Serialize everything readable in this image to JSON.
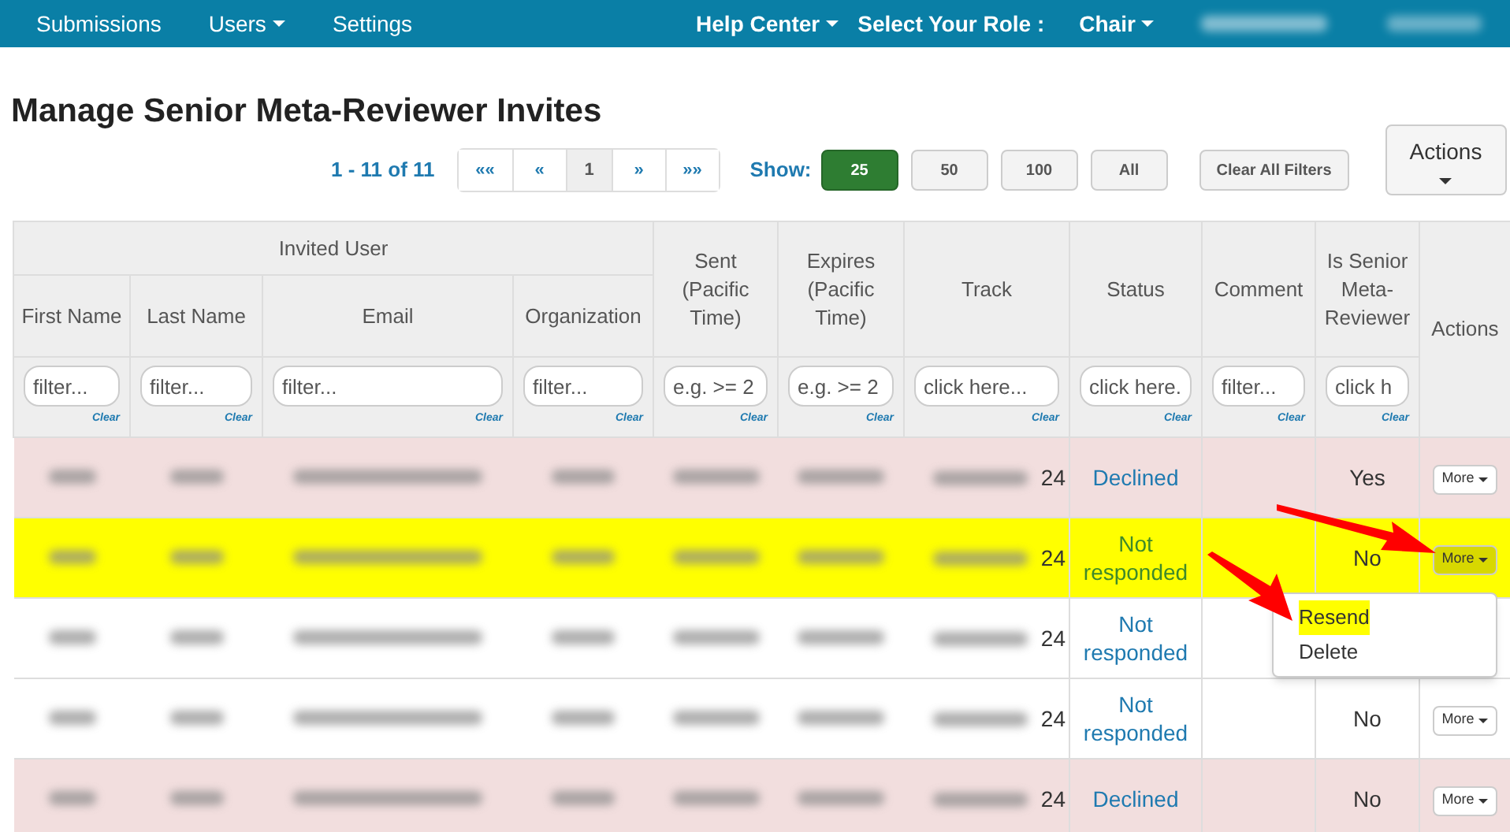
{
  "navbar": {
    "left": [
      {
        "label": "Submissions",
        "caret": false
      },
      {
        "label": "Users",
        "caret": true
      },
      {
        "label": "Settings",
        "caret": false
      }
    ],
    "right": [
      {
        "label": "Help Center",
        "caret": true
      },
      {
        "label": "Select Your Role :",
        "caret": false
      },
      {
        "label": "Chair",
        "caret": true
      }
    ]
  },
  "title": "Manage Senior Meta-Reviewer Invites",
  "pagination": {
    "summary": "1 - 11 of 11",
    "pages": [
      {
        "label": "««",
        "selected": false
      },
      {
        "label": "«",
        "selected": false
      },
      {
        "label": "1",
        "selected": true
      },
      {
        "label": "»",
        "selected": false
      },
      {
        "label": "»»",
        "selected": false
      }
    ]
  },
  "show": {
    "label": "Show:",
    "sizes": [
      {
        "label": "25",
        "selected": true
      },
      {
        "label": "50",
        "selected": false
      },
      {
        "label": "100",
        "selected": false
      },
      {
        "label": "All",
        "selected": false
      }
    ]
  },
  "clear_all_filters": "Clear All Filters",
  "actions_button": "Actions",
  "table": {
    "group_header": "Invited User",
    "columns": [
      {
        "label": "First Name",
        "placeholder": "filter...",
        "clear": "Clear"
      },
      {
        "label": "Last Name",
        "placeholder": "filter...",
        "clear": "Clear"
      },
      {
        "label": "Email",
        "placeholder": "filter...",
        "clear": "Clear"
      },
      {
        "label": "Organization",
        "placeholder": "filter...",
        "clear": "Clear"
      },
      {
        "label": "Sent (Pacific Time)",
        "placeholder": "e.g. >= 2",
        "clear": "Clear"
      },
      {
        "label": "Expires (Pacific Time)",
        "placeholder": "e.g. >= 2",
        "clear": "Clear"
      },
      {
        "label": "Track",
        "placeholder": "click here...",
        "clear": "Clear"
      },
      {
        "label": "Status",
        "placeholder": "click here.",
        "clear": "Clear"
      },
      {
        "label": "Comment",
        "placeholder": "filter...",
        "clear": "Clear"
      },
      {
        "label": "Is Senior Meta-Reviewer",
        "placeholder": "click h",
        "clear": "Clear"
      },
      {
        "label": "Actions"
      }
    ],
    "rows": [
      {
        "track": "24",
        "status": "Declined",
        "kind": "declined",
        "senior": "Yes",
        "action": "More",
        "highlighted": false
      },
      {
        "track": "24",
        "status": "Not responded",
        "kind": "pending",
        "senior": "No",
        "action": "More",
        "highlighted": true
      },
      {
        "track": "24",
        "status": "Not responded",
        "kind": "pending",
        "highlighted": false
      },
      {
        "track": "24",
        "status": "Not responded",
        "kind": "pending",
        "senior": "No",
        "action": "More",
        "highlighted": false
      },
      {
        "track": "24",
        "status": "Declined",
        "kind": "declined",
        "senior": "No",
        "action": "More",
        "highlighted": false
      }
    ]
  },
  "menu": {
    "items": [
      {
        "label": "Resend",
        "highlighted": true
      },
      {
        "label": "Delete",
        "highlighted": false
      }
    ]
  }
}
